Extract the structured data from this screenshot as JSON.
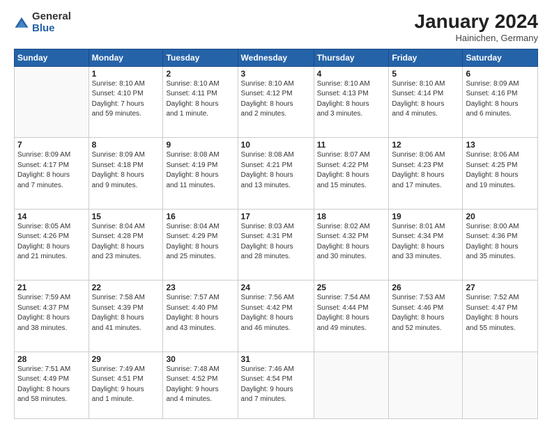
{
  "logo": {
    "general": "General",
    "blue": "Blue"
  },
  "header": {
    "month": "January 2024",
    "location": "Hainichen, Germany"
  },
  "days_of_week": [
    "Sunday",
    "Monday",
    "Tuesday",
    "Wednesday",
    "Thursday",
    "Friday",
    "Saturday"
  ],
  "weeks": [
    [
      {
        "day": "",
        "info": ""
      },
      {
        "day": "1",
        "info": "Sunrise: 8:10 AM\nSunset: 4:10 PM\nDaylight: 7 hours\nand 59 minutes."
      },
      {
        "day": "2",
        "info": "Sunrise: 8:10 AM\nSunset: 4:11 PM\nDaylight: 8 hours\nand 1 minute."
      },
      {
        "day": "3",
        "info": "Sunrise: 8:10 AM\nSunset: 4:12 PM\nDaylight: 8 hours\nand 2 minutes."
      },
      {
        "day": "4",
        "info": "Sunrise: 8:10 AM\nSunset: 4:13 PM\nDaylight: 8 hours\nand 3 minutes."
      },
      {
        "day": "5",
        "info": "Sunrise: 8:10 AM\nSunset: 4:14 PM\nDaylight: 8 hours\nand 4 minutes."
      },
      {
        "day": "6",
        "info": "Sunrise: 8:09 AM\nSunset: 4:16 PM\nDaylight: 8 hours\nand 6 minutes."
      }
    ],
    [
      {
        "day": "7",
        "info": "Sunrise: 8:09 AM\nSunset: 4:17 PM\nDaylight: 8 hours\nand 7 minutes."
      },
      {
        "day": "8",
        "info": "Sunrise: 8:09 AM\nSunset: 4:18 PM\nDaylight: 8 hours\nand 9 minutes."
      },
      {
        "day": "9",
        "info": "Sunrise: 8:08 AM\nSunset: 4:19 PM\nDaylight: 8 hours\nand 11 minutes."
      },
      {
        "day": "10",
        "info": "Sunrise: 8:08 AM\nSunset: 4:21 PM\nDaylight: 8 hours\nand 13 minutes."
      },
      {
        "day": "11",
        "info": "Sunrise: 8:07 AM\nSunset: 4:22 PM\nDaylight: 8 hours\nand 15 minutes."
      },
      {
        "day": "12",
        "info": "Sunrise: 8:06 AM\nSunset: 4:23 PM\nDaylight: 8 hours\nand 17 minutes."
      },
      {
        "day": "13",
        "info": "Sunrise: 8:06 AM\nSunset: 4:25 PM\nDaylight: 8 hours\nand 19 minutes."
      }
    ],
    [
      {
        "day": "14",
        "info": "Sunrise: 8:05 AM\nSunset: 4:26 PM\nDaylight: 8 hours\nand 21 minutes."
      },
      {
        "day": "15",
        "info": "Sunrise: 8:04 AM\nSunset: 4:28 PM\nDaylight: 8 hours\nand 23 minutes."
      },
      {
        "day": "16",
        "info": "Sunrise: 8:04 AM\nSunset: 4:29 PM\nDaylight: 8 hours\nand 25 minutes."
      },
      {
        "day": "17",
        "info": "Sunrise: 8:03 AM\nSunset: 4:31 PM\nDaylight: 8 hours\nand 28 minutes."
      },
      {
        "day": "18",
        "info": "Sunrise: 8:02 AM\nSunset: 4:32 PM\nDaylight: 8 hours\nand 30 minutes."
      },
      {
        "day": "19",
        "info": "Sunrise: 8:01 AM\nSunset: 4:34 PM\nDaylight: 8 hours\nand 33 minutes."
      },
      {
        "day": "20",
        "info": "Sunrise: 8:00 AM\nSunset: 4:36 PM\nDaylight: 8 hours\nand 35 minutes."
      }
    ],
    [
      {
        "day": "21",
        "info": "Sunrise: 7:59 AM\nSunset: 4:37 PM\nDaylight: 8 hours\nand 38 minutes."
      },
      {
        "day": "22",
        "info": "Sunrise: 7:58 AM\nSunset: 4:39 PM\nDaylight: 8 hours\nand 41 minutes."
      },
      {
        "day": "23",
        "info": "Sunrise: 7:57 AM\nSunset: 4:40 PM\nDaylight: 8 hours\nand 43 minutes."
      },
      {
        "day": "24",
        "info": "Sunrise: 7:56 AM\nSunset: 4:42 PM\nDaylight: 8 hours\nand 46 minutes."
      },
      {
        "day": "25",
        "info": "Sunrise: 7:54 AM\nSunset: 4:44 PM\nDaylight: 8 hours\nand 49 minutes."
      },
      {
        "day": "26",
        "info": "Sunrise: 7:53 AM\nSunset: 4:46 PM\nDaylight: 8 hours\nand 52 minutes."
      },
      {
        "day": "27",
        "info": "Sunrise: 7:52 AM\nSunset: 4:47 PM\nDaylight: 8 hours\nand 55 minutes."
      }
    ],
    [
      {
        "day": "28",
        "info": "Sunrise: 7:51 AM\nSunset: 4:49 PM\nDaylight: 8 hours\nand 58 minutes."
      },
      {
        "day": "29",
        "info": "Sunrise: 7:49 AM\nSunset: 4:51 PM\nDaylight: 9 hours\nand 1 minute."
      },
      {
        "day": "30",
        "info": "Sunrise: 7:48 AM\nSunset: 4:52 PM\nDaylight: 9 hours\nand 4 minutes."
      },
      {
        "day": "31",
        "info": "Sunrise: 7:46 AM\nSunset: 4:54 PM\nDaylight: 9 hours\nand 7 minutes."
      },
      {
        "day": "",
        "info": ""
      },
      {
        "day": "",
        "info": ""
      },
      {
        "day": "",
        "info": ""
      }
    ]
  ]
}
